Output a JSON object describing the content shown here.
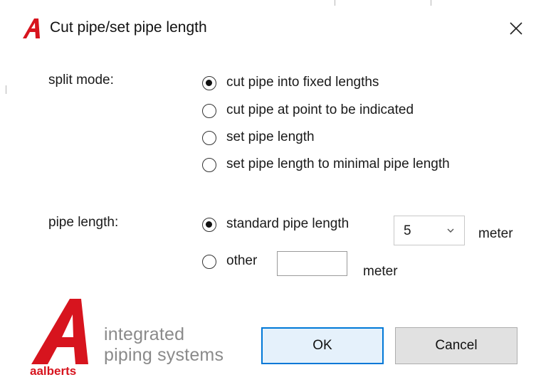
{
  "window": {
    "title": "Cut pipe/set pipe length",
    "close_icon": "close-icon"
  },
  "split_mode": {
    "label": "split mode:",
    "options": [
      {
        "label": "cut pipe into fixed lengths",
        "checked": true
      },
      {
        "label": "cut pipe at point to be indicated",
        "checked": false
      },
      {
        "label": "set pipe length",
        "checked": false
      },
      {
        "label": "set pipe length to minimal pipe length",
        "checked": false
      }
    ]
  },
  "pipe_length": {
    "label": "pipe length:",
    "standard_label": "standard pipe length",
    "standard_checked": true,
    "standard_value": "5",
    "standard_unit": "meter",
    "other_label": "other",
    "other_checked": false,
    "other_value": "",
    "other_unit": "meter"
  },
  "branding": {
    "brand_name": "aalberts",
    "tagline_line1": "integrated",
    "tagline_line2": "piping systems",
    "brand_color": "#d7141e"
  },
  "buttons": {
    "ok_label": "OK",
    "cancel_label": "Cancel"
  },
  "colors": {
    "accent": "#0078d7",
    "ok_bg": "#e5f1fb",
    "cancel_bg": "#e1e1e1"
  }
}
